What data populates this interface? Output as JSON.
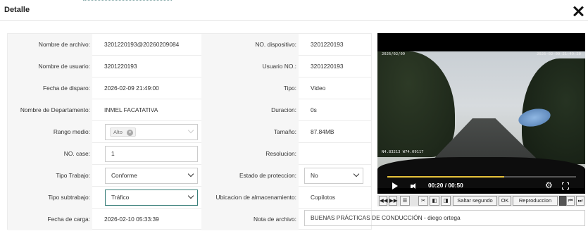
{
  "header": {
    "title": "Detalle"
  },
  "rows": [
    {
      "l1": "Nombre de archivo:",
      "v1": "3201220193@20260209084",
      "l2": "NO. dispositivo:",
      "v2": "3201220193"
    },
    {
      "l1": "Nombre de usuario:",
      "v1": "3201220193",
      "l2": "Usuario NO.:",
      "v2": "3201220193"
    },
    {
      "l1": "Fecha de disparo:",
      "v1": "2026-02-09 21:49:00",
      "l2": "Tipo:",
      "v2": "Video"
    },
    {
      "l1": "Nombre de Departamento:",
      "v1": "INMEL FACATATIVA",
      "l2": "Duracion:",
      "v2": "0s"
    },
    {
      "l1": "Rango medio:",
      "tag": "Alto",
      "l2": "Tamaño:",
      "v2": "87.84MB"
    },
    {
      "l1": "NO. case:",
      "input": "1",
      "l2": "Resolucion:",
      "v2": ""
    },
    {
      "l1": "Tipo Trabajo:",
      "select": "Conforme",
      "l2": "Estado de proteccion:",
      "select2": "No"
    },
    {
      "l1": "Tipo subtrabajo:",
      "select": "Tráfico",
      "l2": "Ubicacion de almacenamiento:",
      "v2": "Copilotos"
    },
    {
      "l1": "Fecha de carga:",
      "v1": "2026-02-10 05:33:39",
      "l2": "Nota de archivo:"
    }
  ],
  "note": "BUENAS PRÁCTICAS DE CONDUCCIÓN - diego ortega",
  "video": {
    "time": "00:20 / 00:50",
    "progress": 0.62,
    "osd_tl": "2026/02/09",
    "osd_tr": "2026-02-09 21:49:20",
    "osd_bl": "N4.83213 W74.09117"
  },
  "controls": {
    "seek_label": "Saltar segundo",
    "ok_label": "OK",
    "mode_label": "Reproduccion"
  },
  "icons": {
    "close": "close-icon",
    "play": "play-icon",
    "volume": "volume-icon",
    "settings": "gear-icon",
    "fullscreen": "fullscreen-icon"
  }
}
